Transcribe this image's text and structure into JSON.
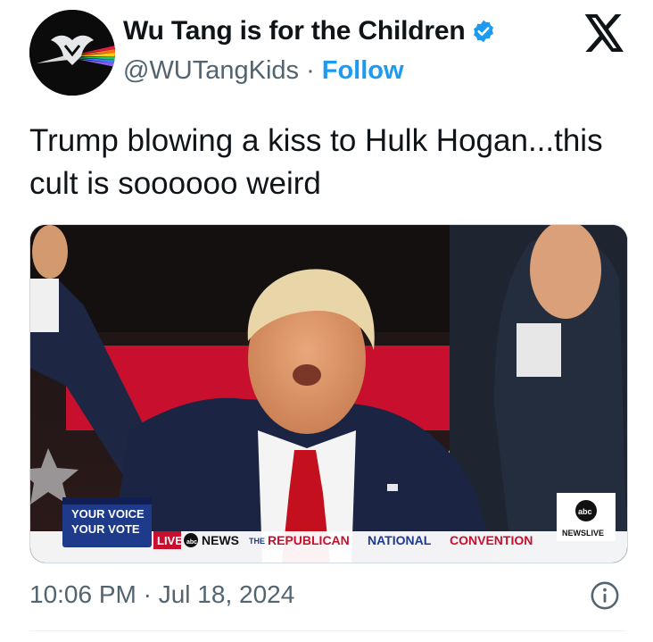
{
  "author": {
    "display_name": "Wu Tang is for the Children",
    "handle": "@WUTangKids",
    "separator": "·",
    "follow_label": "Follow",
    "verified": true,
    "avatar": "wu-tang-prism-logo"
  },
  "tweet": {
    "text": "Trump blowing a kiss to Hulk Hogan...this cult is soooooo weird"
  },
  "media": {
    "broadcast": {
      "bug_line1": "YOUR VOICE",
      "bug_line2": "YOUR VOTE",
      "live_label": "LIVE",
      "network": "NEWS",
      "the": "THE",
      "event_republican": "REPUBLICAN",
      "event_national": "NATIONAL",
      "event_convention": "CONVENTION",
      "corner_logo": "abc",
      "corner_label": "NEWSLIVE"
    }
  },
  "meta": {
    "timestamp": "10:06 PM · Jul 18, 2024"
  },
  "icons": {
    "brand": "x-logo-icon",
    "verified": "verified-badge-icon",
    "info": "info-icon"
  },
  "colors": {
    "follow": "#1d9bf0",
    "verified": "#1d9bf0",
    "muted": "#536471",
    "text": "#0f1419",
    "banner_red": "#c8102e",
    "banner_blue": "#1e3a8a"
  }
}
